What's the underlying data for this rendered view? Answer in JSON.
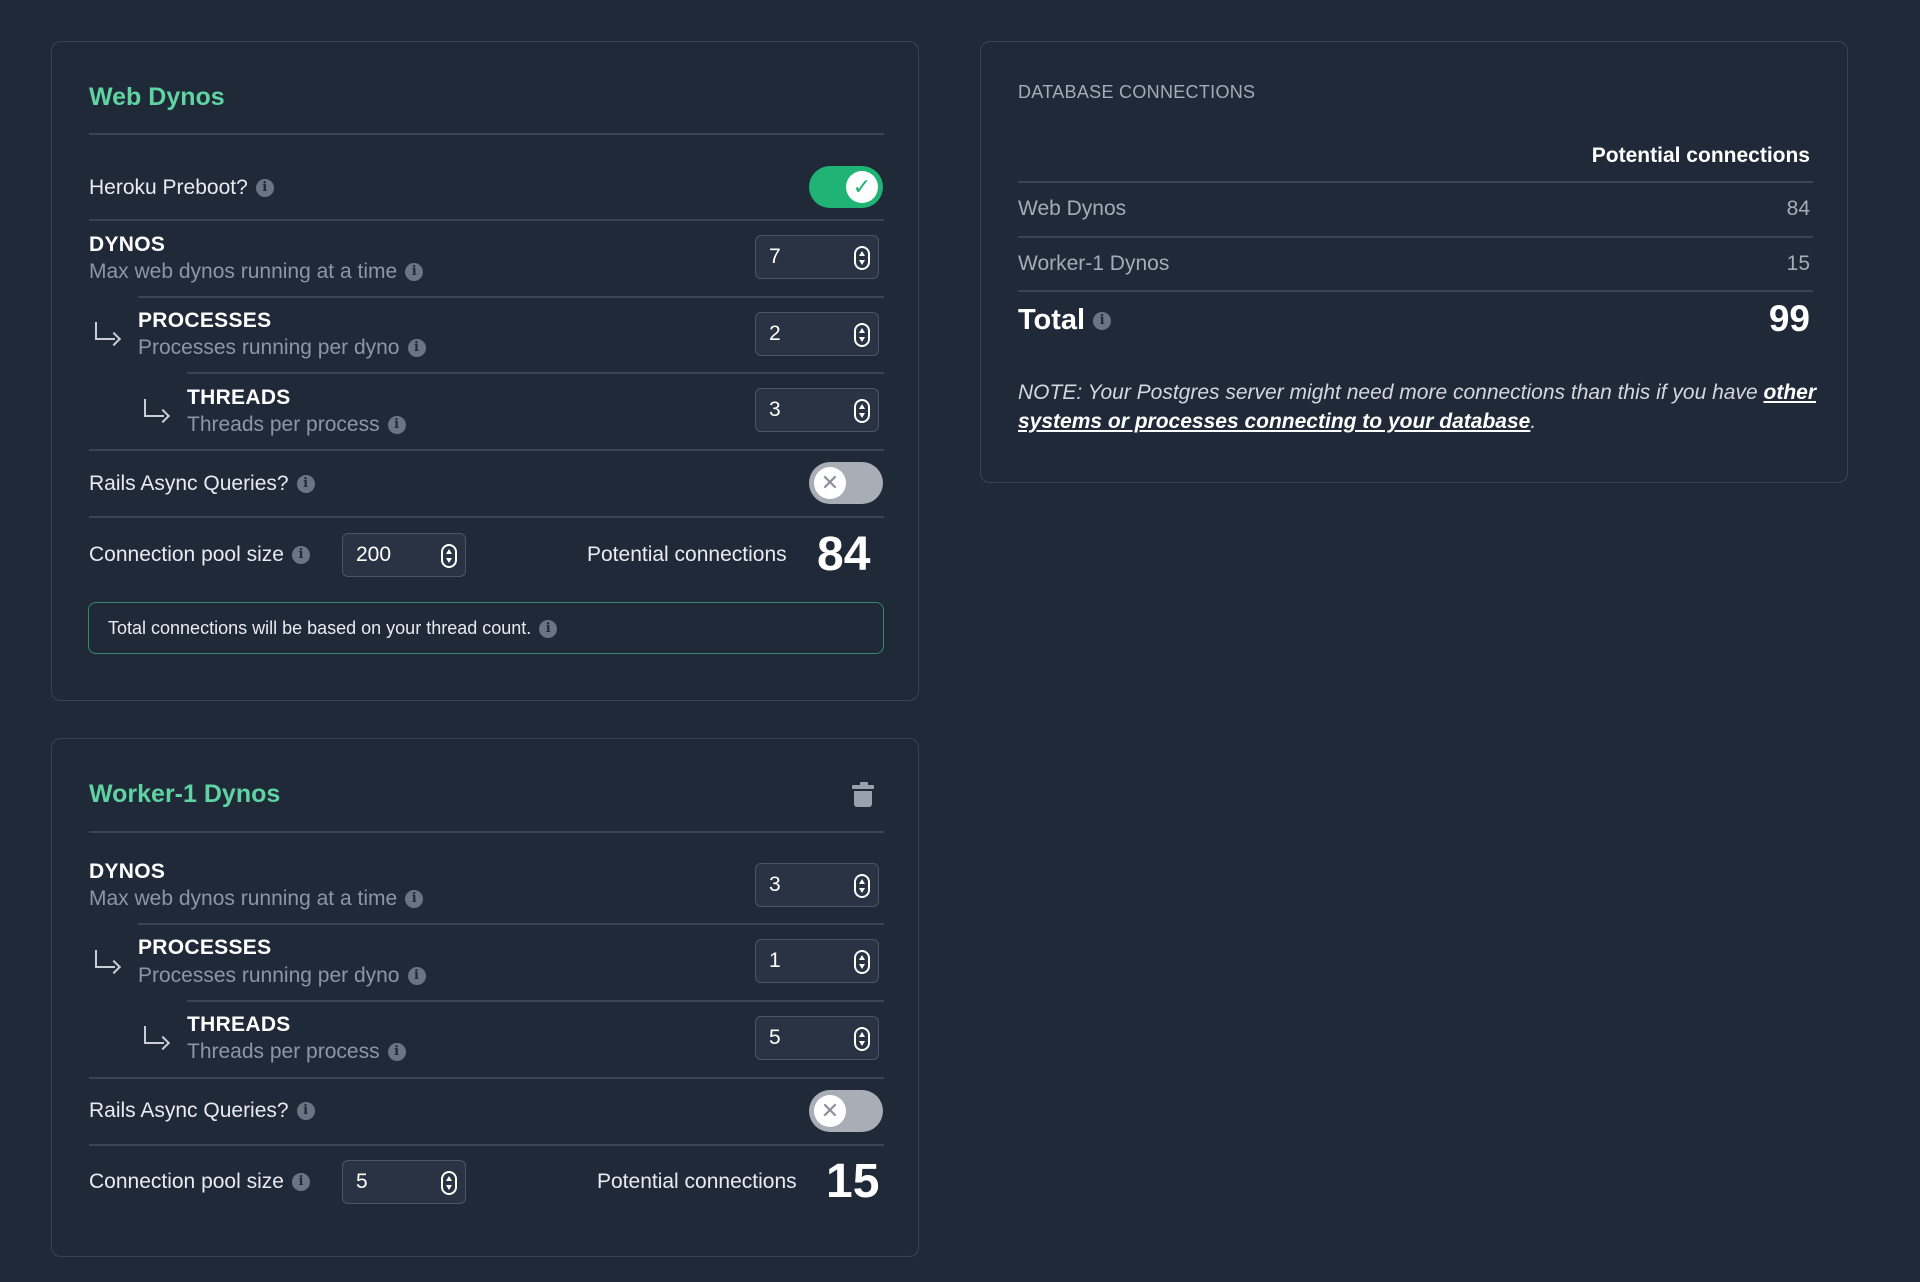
{
  "web_card": {
    "title": "Web Dynos",
    "preboot_label": "Heroku Preboot?",
    "preboot_enabled": true,
    "dynos_label": "DYNOS",
    "dynos_sub": "Max web dynos running at a time",
    "dynos_value": "7",
    "processes_label": "PROCESSES",
    "processes_sub": "Processes running per dyno",
    "processes_value": "2",
    "threads_label": "THREADS",
    "threads_sub": "Threads per process",
    "threads_value": "3",
    "async_label": "Rails Async Queries?",
    "async_enabled": false,
    "pool_label": "Connection pool size",
    "pool_value": "200",
    "potential_label": "Potential connections",
    "potential_value": "84",
    "notice": "Total connections will be based on your thread count."
  },
  "worker_card": {
    "title": "Worker-1 Dynos",
    "dynos_label": "DYNOS",
    "dynos_sub": "Max web dynos running at a time",
    "dynos_value": "3",
    "processes_label": "PROCESSES",
    "processes_sub": "Processes running per dyno",
    "processes_value": "1",
    "threads_label": "THREADS",
    "threads_sub": "Threads per process",
    "threads_value": "5",
    "async_label": "Rails Async Queries?",
    "async_enabled": false,
    "pool_label": "Connection pool size",
    "pool_value": "5",
    "potential_label": "Potential connections",
    "potential_value": "15"
  },
  "db_card": {
    "heading": "DATABASE CONNECTIONS",
    "column_header": "Potential connections",
    "rows": [
      {
        "name": "Web Dynos",
        "value": "84"
      },
      {
        "name": "Worker-1 Dynos",
        "value": "15"
      }
    ],
    "total_label": "Total",
    "total_value": "99",
    "note_prefix": "NOTE: Your Postgres server might need more connections than this if you have ",
    "note_link": "other systems or processes connecting to your database",
    "note_suffix": "."
  },
  "icons": {
    "info": "info-icon",
    "check": "check-icon",
    "close": "close-icon",
    "trash": "trash-icon",
    "arrow": "subitem-arrow-icon"
  },
  "colors": {
    "background": "#202938",
    "accent": "#5fd3a2",
    "toggle_on": "#1fb475",
    "toggle_off": "#a9aeb6"
  }
}
